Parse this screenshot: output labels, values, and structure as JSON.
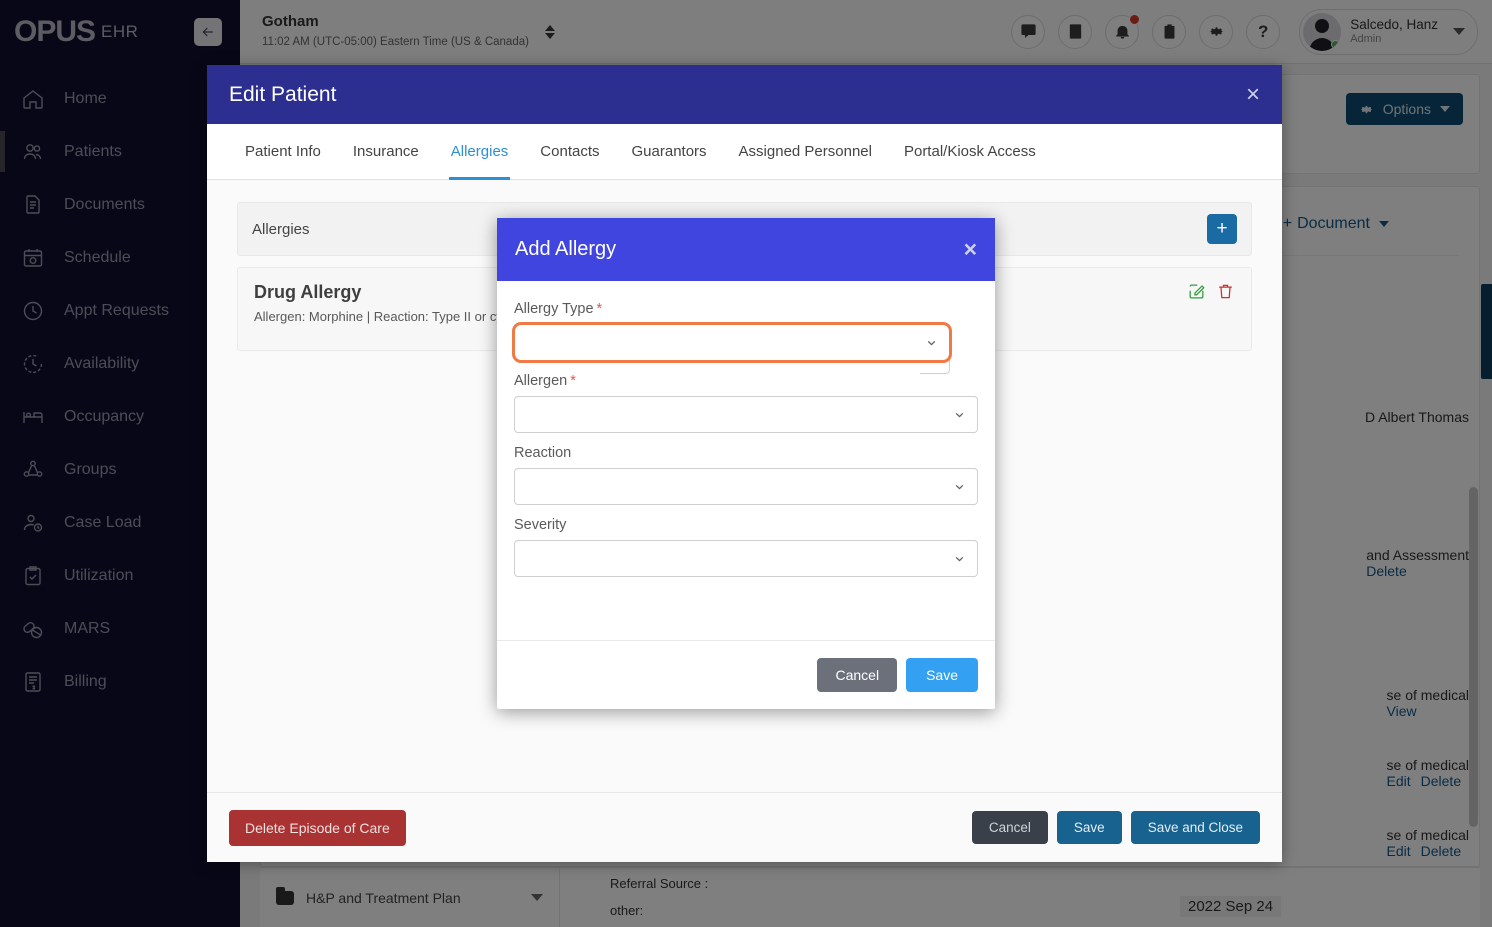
{
  "brand": {
    "logo": "OPUS",
    "suffix": "EHR"
  },
  "sidebar": {
    "items": [
      {
        "label": "Home",
        "icon": "home-icon"
      },
      {
        "label": "Patients",
        "icon": "users-icon"
      },
      {
        "label": "Documents",
        "icon": "documents-icon"
      },
      {
        "label": "Schedule",
        "icon": "calendar-icon"
      },
      {
        "label": "Appt Requests",
        "icon": "clock-icon"
      },
      {
        "label": "Availability",
        "icon": "clock-dashed-icon"
      },
      {
        "label": "Occupancy",
        "icon": "bed-icon"
      },
      {
        "label": "Groups",
        "icon": "group-icon"
      },
      {
        "label": "Case Load",
        "icon": "user-clock-icon"
      },
      {
        "label": "Utilization",
        "icon": "clipboard-check-icon"
      },
      {
        "label": "MARS",
        "icon": "pills-icon"
      },
      {
        "label": "Billing",
        "icon": "invoice-icon"
      }
    ]
  },
  "topbar": {
    "facility_name": "Gotham",
    "facility_time": "11:02 AM (UTC-05:00) Eastern Time (US & Canada)",
    "icons": [
      {
        "name": "messages-icon"
      },
      {
        "name": "notes-icon"
      },
      {
        "name": "bell-icon"
      },
      {
        "name": "clipboard-icon"
      },
      {
        "name": "gear-icon"
      },
      {
        "name": "help-icon"
      }
    ],
    "user_name": "Salcedo, Hanz",
    "user_role": "Admin"
  },
  "background": {
    "options_label": "Options",
    "document_add_label": "Document",
    "author": "D Albert Thomas",
    "rows": [
      {
        "text": "and Assessment",
        "links": [
          "Delete"
        ]
      },
      {
        "text": "se of medical",
        "links": [
          "View"
        ]
      },
      {
        "text": "se of medical",
        "links": [
          "Edit",
          "Delete"
        ]
      },
      {
        "text": "se of medical",
        "links": [
          "Edit",
          "Delete"
        ]
      }
    ],
    "folder_label": "H&P and Treatment Plan",
    "referral_source": "Referral Source :",
    "other": "other:",
    "date": "2022 Sep 24"
  },
  "edit_patient": {
    "title": "Edit Patient",
    "close": "×",
    "tabs": [
      {
        "label": "Patient Info",
        "active": false
      },
      {
        "label": "Insurance",
        "active": false
      },
      {
        "label": "Allergies",
        "active": true
      },
      {
        "label": "Contacts",
        "active": false
      },
      {
        "label": "Guarantors",
        "active": false
      },
      {
        "label": "Assigned Personnel",
        "active": false
      },
      {
        "label": "Portal/Kiosk Access",
        "active": false
      }
    ],
    "section_title": "Allergies",
    "add_button": "+",
    "allergy": {
      "title": "Drug Allergy",
      "details": "Allergen: Morphine | Reaction: Type II or cy"
    },
    "footer": {
      "delete_episode": "Delete Episode of Care",
      "cancel": "Cancel",
      "save": "Save",
      "save_and_close": "Save and Close"
    }
  },
  "add_allergy": {
    "title": "Add Allergy",
    "close": "×",
    "fields": [
      {
        "label": "Allergy Type",
        "required": true,
        "value": "",
        "focused": true
      },
      {
        "label": "Allergen",
        "required": true,
        "value": "",
        "focused": false
      },
      {
        "label": "Reaction",
        "required": false,
        "value": "",
        "focused": false
      },
      {
        "label": "Severity",
        "required": false,
        "value": "",
        "focused": false
      }
    ],
    "cancel": "Cancel",
    "save": "Save"
  },
  "colors": {
    "sidebar_bg": "#0e0e30",
    "edit_modal_header": "#2c2f8f",
    "add_dialog_header": "#4045e0",
    "accent_blue": "#2b8fd4",
    "focus_orange": "#f07a45",
    "danger_red": "#a93333",
    "save_blue": "#33a0f2"
  }
}
